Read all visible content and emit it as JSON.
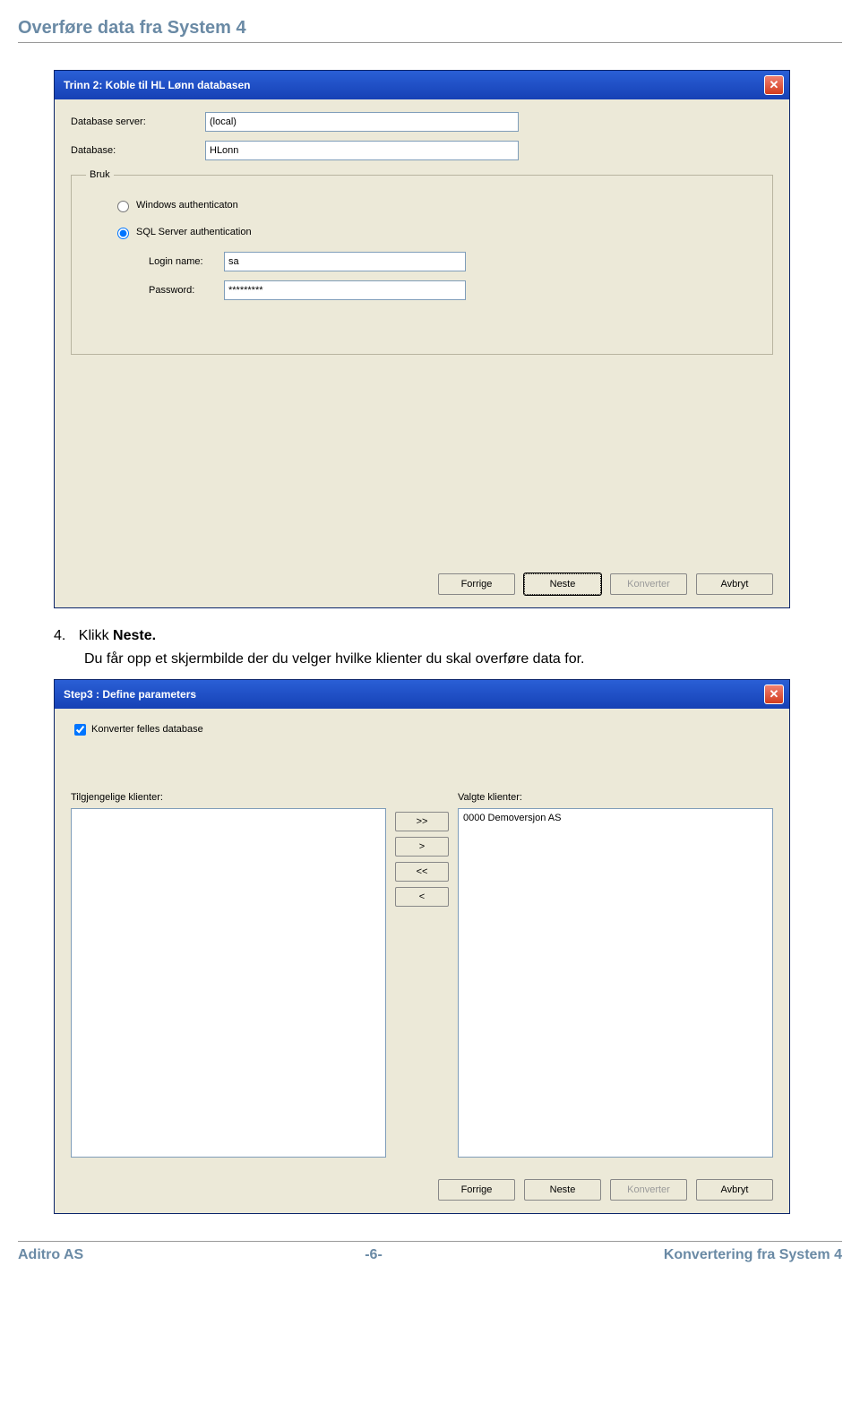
{
  "page": {
    "header": "Overføre data fra System 4",
    "footer_left": "Aditro AS",
    "footer_center": "-6-",
    "footer_right": "Konvertering fra System 4"
  },
  "instruction": {
    "number": "4.",
    "line1a": "Klikk ",
    "line1b": "Neste.",
    "line2": "Du får opp et skjermbilde der du velger hvilke klienter du skal overføre data for."
  },
  "dialog1": {
    "title": "Trinn 2: Koble til HL Lønn databasen",
    "db_server_label": "Database server:",
    "db_server_value": "(local)",
    "db_label": "Database:",
    "db_value": "HLonn",
    "fieldset_legend": "Bruk",
    "radio_windows": "Windows authenticaton",
    "radio_sql": "SQL Server authentication",
    "login_label": "Login name:",
    "login_value": "sa",
    "password_label": "Password:",
    "password_value": "*********",
    "buttons": {
      "prev": "Forrige",
      "next": "Neste",
      "convert": "Konverter",
      "cancel": "Avbryt"
    }
  },
  "dialog2": {
    "title": "Step3 : Define parameters",
    "checkbox_label": "Konverter felles database",
    "available_label": "Tilgjengelige klienter:",
    "selected_label": "Valgte klienter:",
    "move_all_right": ">>",
    "move_right": ">",
    "move_all_left": "<<",
    "move_left": "<",
    "selected_items": [
      "0000  Demoversjon AS"
    ],
    "buttons": {
      "prev": "Forrige",
      "next": "Neste",
      "convert": "Konverter",
      "cancel": "Avbryt"
    }
  }
}
